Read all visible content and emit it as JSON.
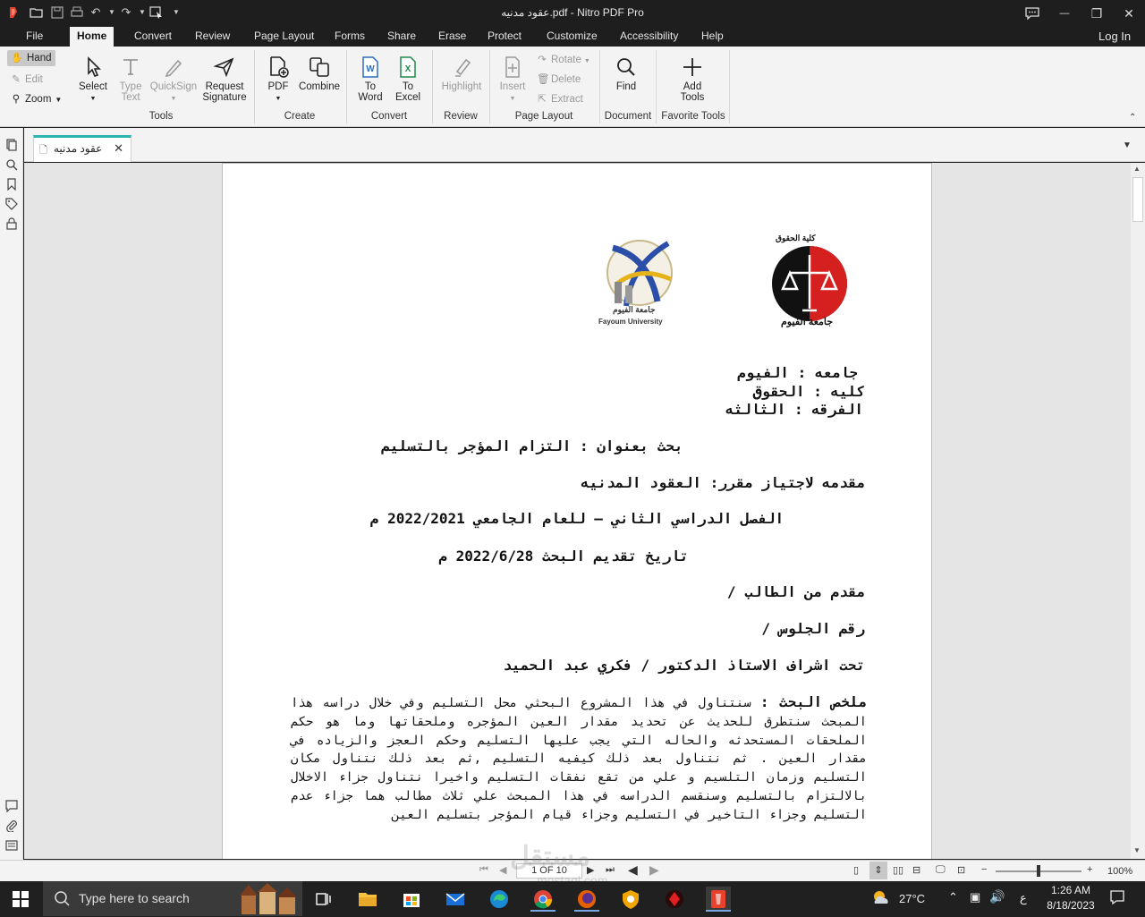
{
  "window": {
    "title": "عقود مدنيه.pdf - Nitro PDF Pro",
    "minimize": "—",
    "restore": "❐",
    "close": "✕",
    "chat_icon": "chat-icon"
  },
  "menubar": {
    "items": [
      "File",
      "Home",
      "Convert",
      "Review",
      "Page Layout",
      "Forms",
      "Share",
      "Erase",
      "Protect",
      "Customize",
      "Accessibility",
      "Help"
    ],
    "active": "Home",
    "login": "Log In"
  },
  "ribbon": {
    "mode": {
      "hand": "Hand",
      "edit": "Edit",
      "zoom": "Zoom"
    },
    "tools": {
      "select": "Select",
      "type_text": "Type Text",
      "quicksign": "QuickSign",
      "request_signature": "Request Signature",
      "group": "Tools"
    },
    "create": {
      "pdf": "PDF",
      "combine": "Combine",
      "group": "Create"
    },
    "convert": {
      "to_word": "To Word",
      "to_excel": "To Excel",
      "group": "Convert"
    },
    "review": {
      "highlight": "Highlight",
      "group": "Review"
    },
    "page_layout": {
      "insert": "Insert",
      "rotate": "Rotate",
      "delete": "Delete",
      "extract": "Extract",
      "group": "Page Layout"
    },
    "document": {
      "find": "Find",
      "group": "Document"
    },
    "favorite": {
      "add_tools": "Add Tools",
      "group": "Favorite Tools"
    }
  },
  "tab": {
    "label": "عقود مدنيه"
  },
  "document": {
    "logo_left_caption": "Fayoum University",
    "logo_left_arabic": "جامعة الفيوم",
    "logo_right_top": "كلية الحقوق",
    "logo_right_bottom": "جامعة الفيوم",
    "line1": "جامعه  :  الفيوم",
    "line2": "كليه  :  الحقوق",
    "line3": "الفرقه : الثالثه",
    "title": "بحث بعنوان : التزام المؤجر بالتسليم",
    "course": "مقدمه لاجتياز مقرر: العقود المدنيه",
    "semester": "الفصل الدراسي الثاني – للعام الجامعي 2022/2021 م",
    "date": "تاريخ تقديم البحث 2022/6/28 م",
    "student": "مقدم من الطالب /",
    "seat": "رقم الجلوس  /",
    "supervisor": "تحت اشراف الاستاذ الدكتور / فكري عبد الحميد",
    "abstract_label": "ملخص البحث :",
    "abstract_text": "سنتناول في هذا المشروع البحثي محل التسليم وفي خلال دراسه هذا المبحث سنتطرق للحديث عن تحديد مقدار العين المؤجره وملحقاتها وما هو حكم الملحقات المستحدثه والحاله التي يجب عليها التسليم وحكم العجز والزياده في مقدار العين . ثم نتناول بعد ذلك كيفيه التسليم ,ثم بعد ذلك نتناول مكان التسليم وزمان التلسيم و علي من تقع نفقات التسليم واخيرا نتناول جزاء الاخلال بالالتزام بالتسليم وسنقسم الدراسه في هذا المبحث علي ثلاث مطالب هما جزاء عدم التسليم وجزاء التاخير في التسليم وجزاء قيام المؤجر بتسليم العين"
  },
  "status": {
    "page": "1 OF 10",
    "zoom": "100%",
    "watermark": "مستقل",
    "watermark_url": "mostaql.com"
  },
  "taskbar": {
    "search_placeholder": "Type here to search",
    "weather": "27°C",
    "lang": "ع",
    "time": "1:26 AM",
    "date": "8/18/2023"
  }
}
